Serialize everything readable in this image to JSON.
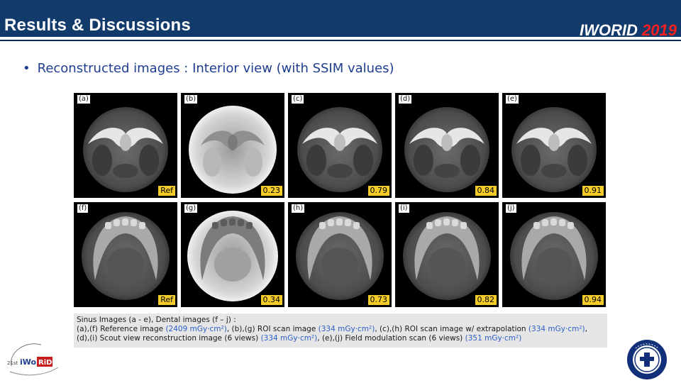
{
  "header": {
    "title": "Results & Discussions",
    "brand_main": "IWORID",
    "brand_year": "2019",
    "brand_color": "#ff1e1e",
    "bar_color": "#123a6b"
  },
  "bullet": "Reconstructed images : Interior view (with SSIM values)",
  "images": {
    "row1": [
      {
        "label": "(a)",
        "value": "Ref",
        "kind": "sinus-ref"
      },
      {
        "label": "(b)",
        "value": "0.23",
        "kind": "sinus-roi"
      },
      {
        "label": "(c)",
        "value": "0.79",
        "kind": "sinus-ext"
      },
      {
        "label": "(d)",
        "value": "0.84",
        "kind": "sinus-scout"
      },
      {
        "label": "(e)",
        "value": "0.91",
        "kind": "sinus-field"
      }
    ],
    "row2": [
      {
        "label": "(f)",
        "value": "Ref",
        "kind": "dental-ref"
      },
      {
        "label": "(g)",
        "value": "0.34",
        "kind": "dental-roi"
      },
      {
        "label": "(h)",
        "value": "0.73",
        "kind": "dental-ext"
      },
      {
        "label": "(i)",
        "value": "0.82",
        "kind": "dental-scout"
      },
      {
        "label": "(j)",
        "value": "0.94",
        "kind": "dental-field"
      }
    ]
  },
  "caption": {
    "line1": "Sinus Images (a - e), Dental images (f – j) :",
    "line2_a": "(a),(f) Reference image ",
    "line2_b": "(2409 mGy·cm²)",
    "line2_c": ", (b),(g) ROI scan image ",
    "line2_d": "(334 mGy·cm²)",
    "line2_e": ", (c),(h) ROI scan image w/ extrapolation ",
    "line2_f": "(334 mGy·cm²)",
    "line2_g": ",",
    "line3_a": "(d),(i) Scout view reconstruction image (6 views) ",
    "line3_b": "(334 mGy·cm²)",
    "line3_c": ", (e),(j) Field modulation scan (6 views) ",
    "line3_d": "(351 mGy·cm²)"
  },
  "logo_left": {
    "alt": "21st iWoRiD International Workshop on Radiation Imaging Detectors"
  },
  "logo_right": {
    "alt": "YONSEI UNIVERSITY"
  }
}
